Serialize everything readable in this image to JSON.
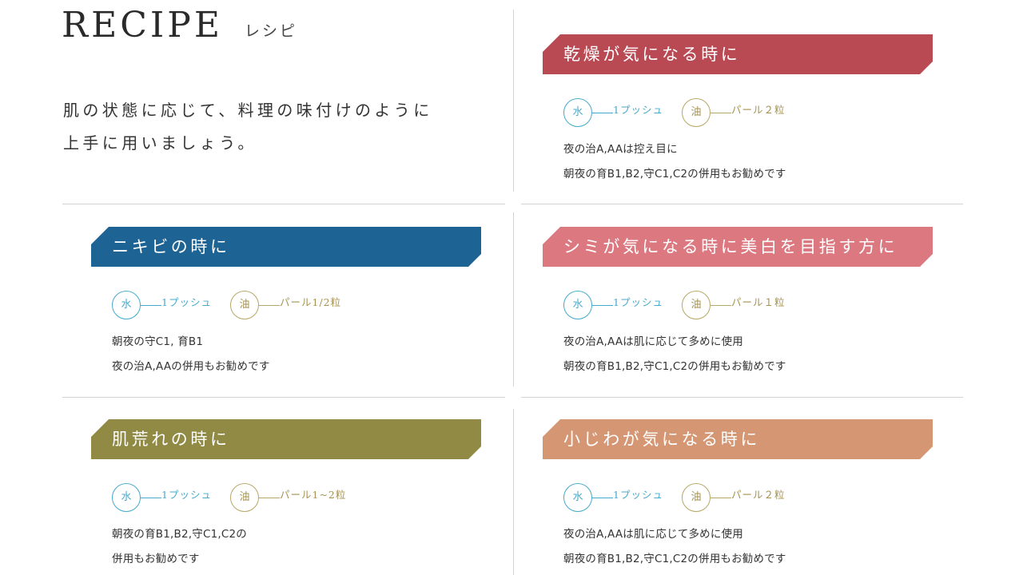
{
  "header": {
    "title": "RECIPE",
    "subtitle": "レシピ"
  },
  "intro": {
    "lines": [
      "肌の状態に応じて、料理の味付けのように",
      "上手に用いましょう。"
    ]
  },
  "colors": {
    "dry": "#b94a54",
    "acne": "#1d6494",
    "spots": "#dc7880",
    "rough": "#908a45",
    "wrinkles": "#d59773",
    "water": "#46aacb",
    "oil": "#b7a766"
  },
  "cards": {
    "dry": {
      "title": "乾燥が気になる時に",
      "water_label": "水",
      "water_amount": "1プッシュ",
      "oil_label": "油",
      "oil_amount": "パール２粒",
      "desc": [
        "夜の治A,AAは控え目に",
        "朝夜の育B1,B2,守C1,C2の併用もお勧めです"
      ]
    },
    "acne": {
      "title": "ニキビの時に",
      "water_label": "水",
      "water_amount": "1プッシュ",
      "oil_label": "油",
      "oil_amount": "パール1/2粒",
      "desc": [
        "朝夜の守C1, 育B1",
        "夜の治A,AAの併用もお勧めです"
      ]
    },
    "spots": {
      "title": "シミが気になる時に美白を目指す方に",
      "water_label": "水",
      "water_amount": "1プッシュ",
      "oil_label": "油",
      "oil_amount": "パール１粒",
      "desc": [
        "夜の治A,AAは肌に応じて多めに使用",
        "朝夜の育B1,B2,守C1,C2の併用もお勧めです"
      ]
    },
    "rough": {
      "title": "肌荒れの時に",
      "water_label": "水",
      "water_amount": "1プッシュ",
      "oil_label": "油",
      "oil_amount": "パール1~2粒",
      "desc": [
        "朝夜の育B1,B2,守C1,C2の",
        "併用もお勧めです"
      ]
    },
    "wrinkles": {
      "title": "小じわが気になる時に",
      "water_label": "水",
      "water_amount": "1プッシュ",
      "oil_label": "油",
      "oil_amount": "パール２粒",
      "desc": [
        "夜の治A,AAは肌に応じて多めに使用",
        "朝夜の育B1,B2,守C1,C2の併用もお勧めです"
      ]
    }
  }
}
